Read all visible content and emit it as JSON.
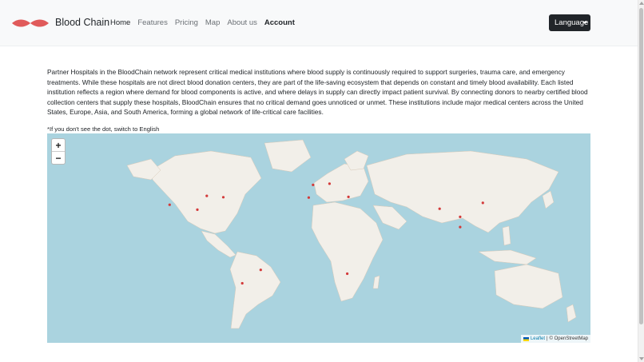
{
  "header": {
    "brand": "Blood Chain",
    "nav": {
      "home": "Home",
      "features": "Features",
      "pricing": "Pricing",
      "map": "Map",
      "about": "About us",
      "account": "Account"
    },
    "language_button": "Language",
    "logo_icon": "blood-drop-logo-icon",
    "logo_color": "#e05a5a"
  },
  "main": {
    "intro": "Partner Hospitals in the BloodChain network represent critical medical institutions where blood supply is continuously required to support surgeries, trauma care, and emergency treatments. While these hospitals are not direct blood donation centers, they are part of the life-saving ecosystem that depends on constant and timely blood availability. Each listed institution reflects a region where demand for blood components is active, and where delays in supply can directly impact patient survival. By connecting donors to nearby certified blood collection centers that supply these hospitals, BloodChain ensures that no critical demand goes unnoticed or unmet. These institutions include major medical centers across the United States, Europe, Asia, and South America, forming a global network of life-critical care facilities.",
    "note": "*If you don't see the dot, switch to English"
  },
  "map": {
    "zoom_in": "+",
    "zoom_out": "−",
    "attribution_leaflet": "Leaflet",
    "attribution_separator": "|",
    "attribution_copyright": "© OpenStreetMap",
    "water_color": "#aad3df",
    "land_color": "#f2efe9",
    "marker_color": "#d33a3a",
    "markers": [
      {
        "lat": 41.9,
        "lon": -87.6
      },
      {
        "lat": 40.7,
        "lon": -74.0
      },
      {
        "lat": 34.1,
        "lon": -118.2
      },
      {
        "lat": 29.8,
        "lon": -95.4
      },
      {
        "lat": -22.9,
        "lon": -43.2
      },
      {
        "lat": -34.6,
        "lon": -58.4
      },
      {
        "lat": 51.5,
        "lon": -0.1
      },
      {
        "lat": 52.5,
        "lon": 13.4
      },
      {
        "lat": 40.4,
        "lon": -3.7
      },
      {
        "lat": 41.0,
        "lon": 29.0
      },
      {
        "lat": -26.2,
        "lon": 28.0
      },
      {
        "lat": 30.6,
        "lon": 104.1
      },
      {
        "lat": 35.7,
        "lon": 139.7
      },
      {
        "lat": 23.5,
        "lon": 121.0
      },
      {
        "lat": 14.6,
        "lon": 121.0
      }
    ]
  }
}
